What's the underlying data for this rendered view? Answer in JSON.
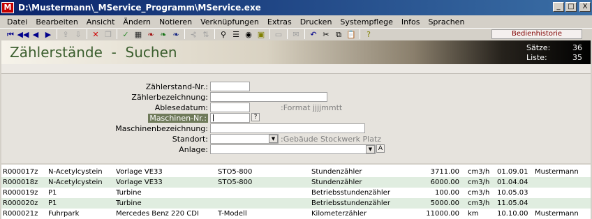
{
  "window": {
    "title": "D:\\Mustermann\\_MService_Programm\\MService.exe",
    "icon_text": "M",
    "buttons": [
      "_",
      "□",
      "X"
    ]
  },
  "menu": [
    "Datei",
    "Bearbeiten",
    "Ansicht",
    "Ändern",
    "Notieren",
    "Verknüpfungen",
    "Extras",
    "Drucken",
    "Systempflege",
    "Infos",
    "Sprachen"
  ],
  "toolbar": {
    "icons": [
      {
        "name": "first-record-icon",
        "glyph": "⏮",
        "color": "#00008b"
      },
      {
        "name": "prev-page-icon",
        "glyph": "◀◀",
        "color": "#00008b"
      },
      {
        "name": "prev-record-icon",
        "glyph": "◀",
        "color": "#00008b"
      },
      {
        "name": "next-record-icon",
        "glyph": "▶",
        "color": "#00008b"
      },
      {
        "name": "sep",
        "glyph": ""
      },
      {
        "name": "export-icon",
        "glyph": "⇪",
        "color": "#a0a0a0"
      },
      {
        "name": "import-icon",
        "glyph": "⇩",
        "color": "#a0a0a0"
      },
      {
        "name": "sep",
        "glyph": ""
      },
      {
        "name": "delete-icon",
        "glyph": "✕",
        "color": "#d00000"
      },
      {
        "name": "copy-record-icon",
        "glyph": "❐",
        "color": "#a0a0a0"
      },
      {
        "name": "sep",
        "glyph": ""
      },
      {
        "name": "confirm-icon",
        "glyph": "✓",
        "color": "#2a8a2a"
      },
      {
        "name": "calculator-icon",
        "glyph": "▦",
        "color": "#303030"
      },
      {
        "name": "tool-red-icon",
        "glyph": "❧",
        "color": "#a01010"
      },
      {
        "name": "tool-green-icon",
        "glyph": "❧",
        "color": "#107010"
      },
      {
        "name": "tool-blue-icon",
        "glyph": "❧",
        "color": "#102080"
      },
      {
        "name": "sep",
        "glyph": ""
      },
      {
        "name": "link-icon",
        "glyph": "⊰",
        "color": "#a0a0a0"
      },
      {
        "name": "sort-icon",
        "glyph": "⇅",
        "color": "#a0a0a0"
      },
      {
        "name": "sep",
        "glyph": ""
      },
      {
        "name": "binoculars-icon",
        "glyph": "⚲",
        "color": "#000000"
      },
      {
        "name": "list-icon",
        "glyph": "☰",
        "color": "#000000"
      },
      {
        "name": "view-icon",
        "glyph": "◉",
        "color": "#000000"
      },
      {
        "name": "image-icon",
        "glyph": "▣",
        "color": "#808000"
      },
      {
        "name": "sep",
        "glyph": ""
      },
      {
        "name": "print-icon",
        "glyph": "▭",
        "color": "#a0a0a0"
      },
      {
        "name": "sep",
        "glyph": ""
      },
      {
        "name": "mail-icon",
        "glyph": "✉",
        "color": "#a0a0a0"
      },
      {
        "name": "sep",
        "glyph": ""
      },
      {
        "name": "undo-icon",
        "glyph": "↶",
        "color": "#00008b"
      },
      {
        "name": "cut-icon",
        "glyph": "✂",
        "color": "#000000"
      },
      {
        "name": "copy-icon",
        "glyph": "⧉",
        "color": "#000000"
      },
      {
        "name": "paste-icon",
        "glyph": "📋",
        "color": "#000000"
      },
      {
        "name": "sep",
        "glyph": ""
      },
      {
        "name": "help-icon",
        "glyph": "?",
        "color": "#808000"
      }
    ],
    "history_button": "Bedienhistorie"
  },
  "header": {
    "title": "Zählerstände  -  Suchen",
    "saetze_label": "Sätze:",
    "saetze_value": "36",
    "liste_label": "Liste:",
    "liste_value": "35"
  },
  "form": {
    "zaehlerstand_nr": {
      "label": "Zählerstand-Nr.:",
      "value": ""
    },
    "zaehlerbezeichnung": {
      "label": "Zählerbezeichnung:",
      "value": ""
    },
    "ablesedatum": {
      "label": "Ablesedatum:",
      "value": "",
      "hint": ":Format jjjjmmtt"
    },
    "maschinen_nr": {
      "label": "Maschinen-Nr.:",
      "value": "",
      "button": "?"
    },
    "maschinenbezeichnung": {
      "label": "Maschinenbezeichnung:",
      "value": ""
    },
    "standort": {
      "label": "Standort:",
      "value": "",
      "hint": ":Gebäude Stockwerk Platz"
    },
    "anlage": {
      "label": "Anlage:",
      "value": "",
      "button": "A"
    }
  },
  "table": {
    "rows": [
      [
        "R000017z",
        "N-Acetylcystein",
        "Vorlage VE33",
        "STO5-800",
        "Stundenzähler",
        "3711.00",
        "cm3/h",
        "01.09.01",
        "Mustermann"
      ],
      [
        "R000018z",
        "N-Acetylcystein",
        "Vorlage VE33",
        "STO5-800",
        "Stundenzähler",
        "6000.00",
        "cm3/h",
        "01.04.04",
        ""
      ],
      [
        "R000019z",
        "P1",
        "Turbine",
        "",
        "Betriebsstundenzähler",
        "100.00",
        "cm3/h",
        "10.05.03",
        ""
      ],
      [
        "R000020z",
        "P1",
        "Turbine",
        "",
        "Betriebsstundenzähler",
        "5000.00",
        "cm3/h",
        "11.05.04",
        ""
      ],
      [
        "R000021z",
        "Fuhrpark",
        "Mercedes Benz 220 CDI",
        "T-Modell",
        "Kilometerzähler",
        "11000.00",
        "km",
        "10.10.00",
        "Mustermann"
      ]
    ]
  }
}
